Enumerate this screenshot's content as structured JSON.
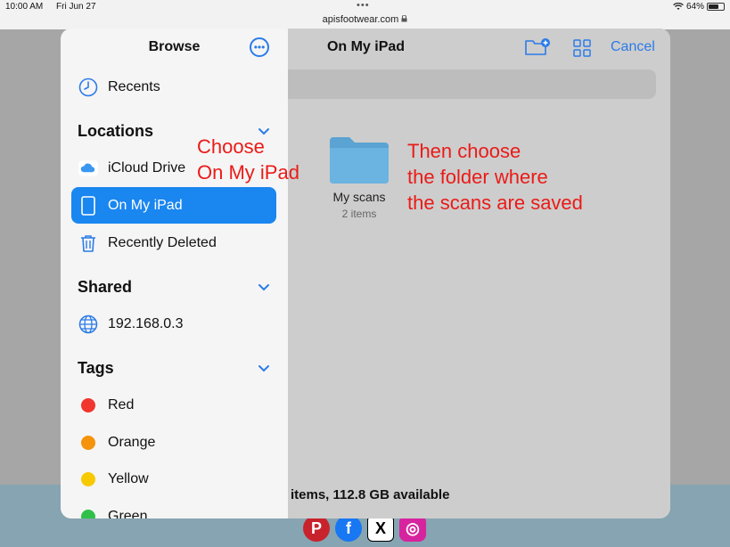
{
  "status_bar": {
    "time": "10:00 AM",
    "date": "Fri Jun 27",
    "url": "apisfootwear.com",
    "battery": "64%"
  },
  "sidebar": {
    "title": "Browse",
    "recents": "Recents",
    "locations_header": "Locations",
    "locations": [
      {
        "label": "iCloud Drive"
      },
      {
        "label": "On My iPad"
      },
      {
        "label": "Recently Deleted"
      }
    ],
    "shared_header": "Shared",
    "shared": [
      {
        "label": "192.168.0.3"
      }
    ],
    "tags_header": "Tags",
    "tags": [
      {
        "label": "Red",
        "color": "#f0362f"
      },
      {
        "label": "Orange",
        "color": "#f5930a"
      },
      {
        "label": "Yellow",
        "color": "#f7c900"
      },
      {
        "label": "Green",
        "color": "#30c04a"
      }
    ]
  },
  "main": {
    "title": "On My iPad",
    "cancel_label": "Cancel",
    "folder": {
      "name": "My scans",
      "count": "2 items"
    },
    "storage_text": "items, 112.8 GB available"
  },
  "annotations": {
    "choose_line1": "Choose",
    "choose_line2": "On My iPad",
    "then_line1": "Then choose",
    "then_line2": "the folder where",
    "then_line3": "the scans are saved"
  },
  "colors": {
    "accent": "#2b7be8",
    "selected": "#1a86f0",
    "annotation": "#ea1b17"
  }
}
